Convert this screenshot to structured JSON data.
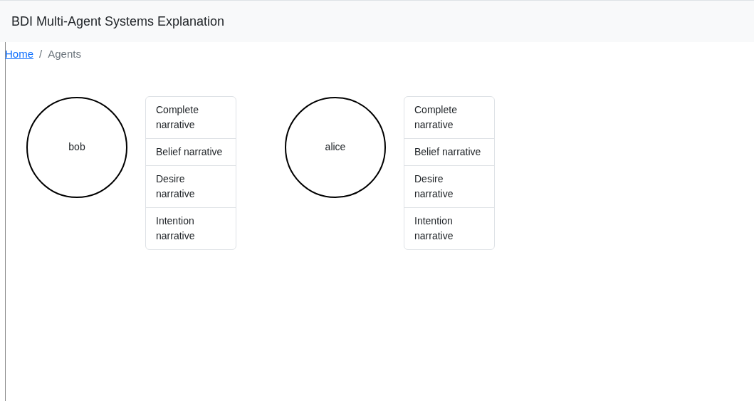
{
  "navbar": {
    "title": "BDI Multi-Agent Systems Explanation"
  },
  "breadcrumb_separator": "/",
  "breadcrumb": [
    {
      "label": "Home",
      "kind": "link"
    },
    {
      "label": "Agents",
      "kind": "current"
    }
  ],
  "agents": [
    {
      "name": "bob",
      "narratives": [
        "Complete narrative",
        "Belief narrative",
        "Desire narrative",
        "Intention narrative"
      ]
    },
    {
      "name": "alice",
      "narratives": [
        "Complete narrative",
        "Belief narrative",
        "Desire narrative",
        "Intention narrative"
      ]
    }
  ]
}
